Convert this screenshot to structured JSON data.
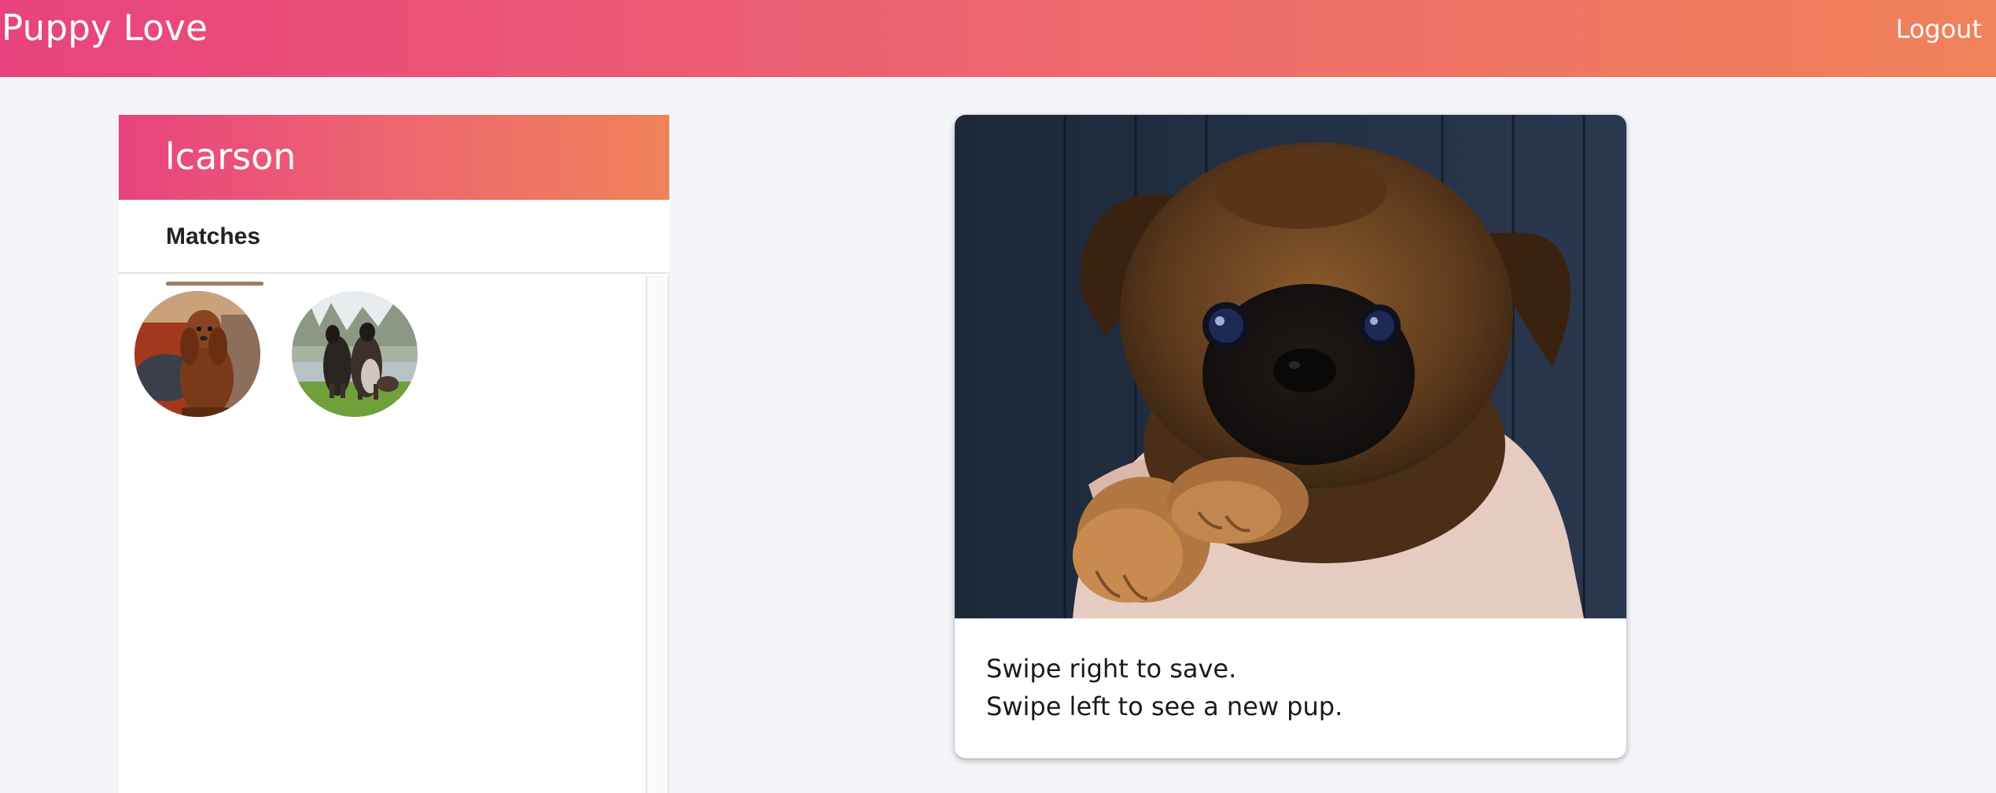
{
  "app": {
    "title": "Puppy Love",
    "logout_label": "Logout"
  },
  "sidebar": {
    "username": "lcarson",
    "tabs": [
      {
        "label": "Matches",
        "active": true
      }
    ],
    "matches": [
      {
        "icon": "spaniel-photo"
      },
      {
        "icon": "afghan-hounds-photo"
      }
    ]
  },
  "card": {
    "photo_icon": "puppy-photo",
    "instructions": [
      "Swipe right to save.",
      "Swipe left to see a new pup."
    ]
  },
  "colors": {
    "gradient_start": "#e8437e",
    "gradient_end": "#f08259",
    "tab_underline": "#a17b67",
    "background": "#f4f5f9"
  }
}
